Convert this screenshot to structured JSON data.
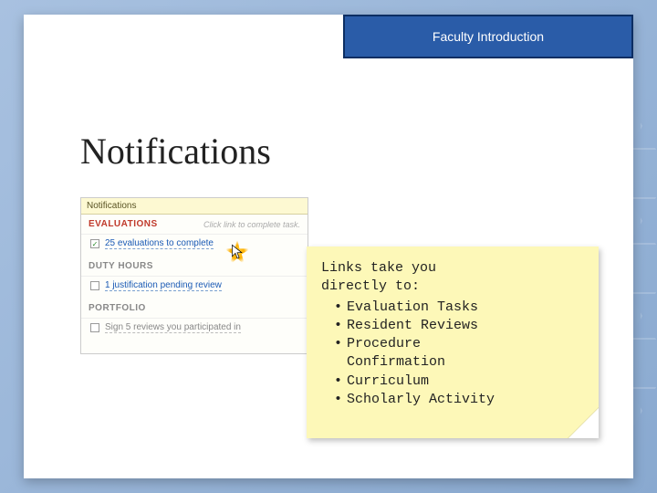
{
  "titlebar": {
    "text": "Faculty Introduction"
  },
  "heading": "Notifications",
  "panel": {
    "header": "Notifications",
    "sections": {
      "evaluations": {
        "label": "EVALUATIONS",
        "hint": "Click link to complete task."
      },
      "duty_hours": {
        "label": "DUTY HOURS"
      },
      "portfolio": {
        "label": "PORTFOLIO"
      }
    },
    "items": {
      "evals_link": "25 evaluations to complete",
      "justif_link": "1 justification pending review",
      "sign_reviews": "Sign 5 reviews you participated in"
    },
    "checks": {
      "on": "✓",
      "off": ""
    }
  },
  "sticky": {
    "intro1": "Links take you",
    "intro2": "directly to:",
    "bullets": [
      "Evaluation Tasks",
      "Resident Reviews",
      "Procedure",
      "Confirmation",
      "Curriculum",
      "Scholarly Activity"
    ],
    "bullet_char": "•"
  }
}
